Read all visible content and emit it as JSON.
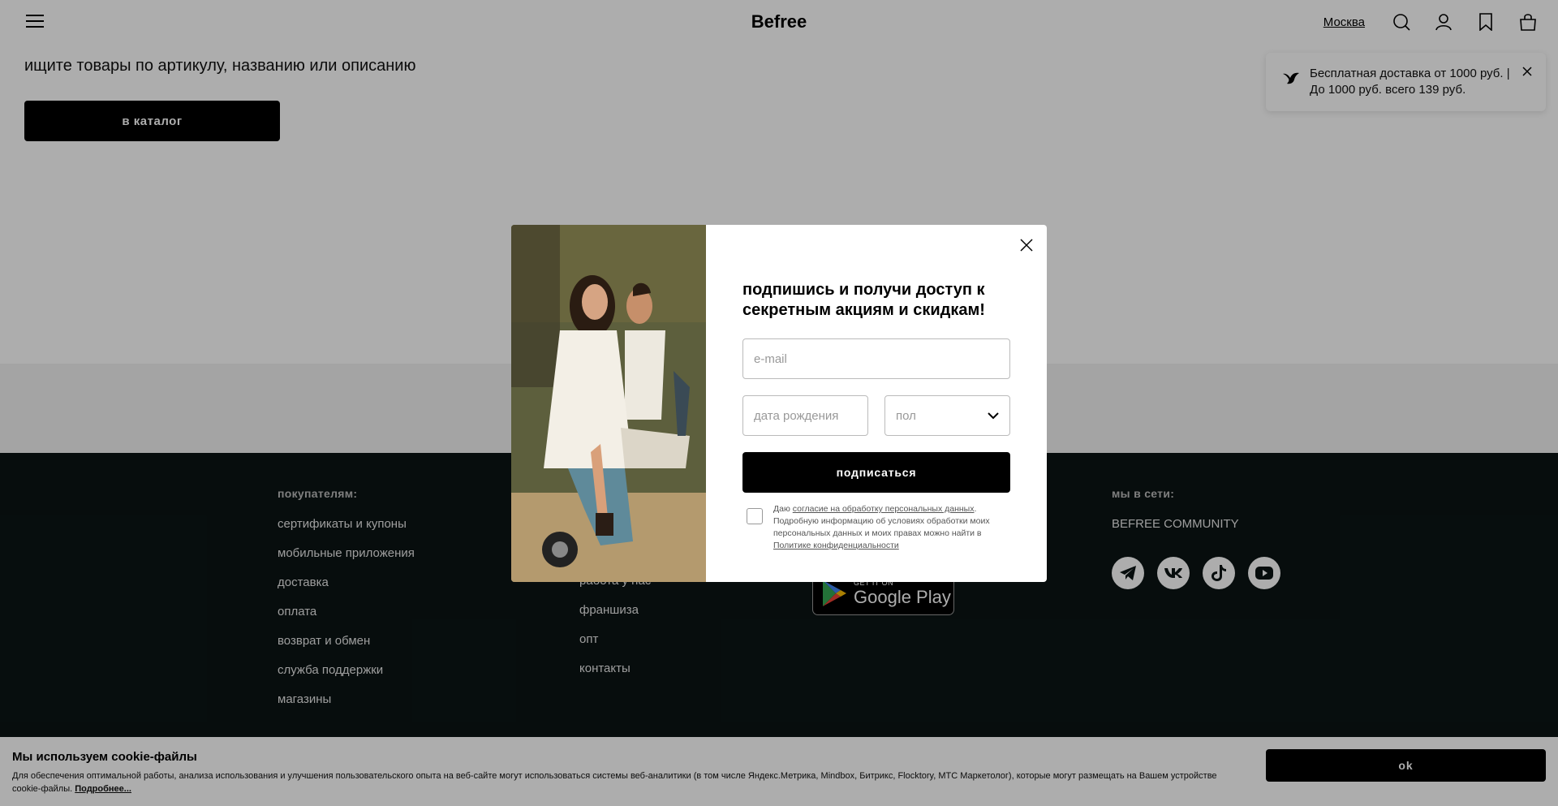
{
  "header": {
    "logo": "Befree",
    "city": "Москва"
  },
  "main": {
    "search_hint": "ищите товары по артикулу, названию или описанию",
    "catalog_button": "в каталог"
  },
  "toast": {
    "text": "Бесплатная доставка от 1000 руб. | До 1000 руб. всего 139 руб."
  },
  "footer": {
    "customers_heading": "покупателям:",
    "customers_links": [
      "сертификаты и купоны",
      "мобильные приложения",
      "доставка",
      "оплата",
      "возврат и обмен",
      "служба поддержки",
      "магазины"
    ],
    "company_links": [
      "работа у нас",
      "франшиза",
      "опт",
      "контакты"
    ],
    "social_heading": "мы в сети:",
    "community": "BEFREE COMMUNITY",
    "google_play_small": "GET IT ON",
    "google_play_big": "Google Play",
    "social_icons": [
      "telegram-icon",
      "vk-icon",
      "tiktok-icon",
      "youtube-icon"
    ]
  },
  "modal": {
    "title": "подпишись и получи доступ к секретным акциям и скидкам!",
    "email_placeholder": "e-mail",
    "birthdate_placeholder": "дата рождения",
    "sex_placeholder": "пол",
    "subscribe_button": "подписаться",
    "consent_prefix": "Даю ",
    "consent_link": "согласие на обработку персональных данных",
    "consent_middle": ". Подробную информацию об условиях обработки моих персональных данных и моих правах можно найти в ",
    "privacy_link": "Политике конфиденциальности"
  },
  "cookie": {
    "title": "Мы используем cookie-файлы",
    "text": "Для обеспечения оптимальной работы, анализа использования и улучшения пользовательского опыта на веб-сайте могут использоваться системы веб-аналитики (в том числе Яндекс.Метрика, Mindbox, Битрикс, Flocktory, МТС Маркетолог), которые могут размещать на Вашем устройстве cookie-файлы. ",
    "more_link": "Подробнее...",
    "ok_button": "ok"
  },
  "colors": {
    "footer_bg": "#0b1414",
    "button_bg": "#000000",
    "overlay": "rgba(0,0,0,0.32)"
  }
}
